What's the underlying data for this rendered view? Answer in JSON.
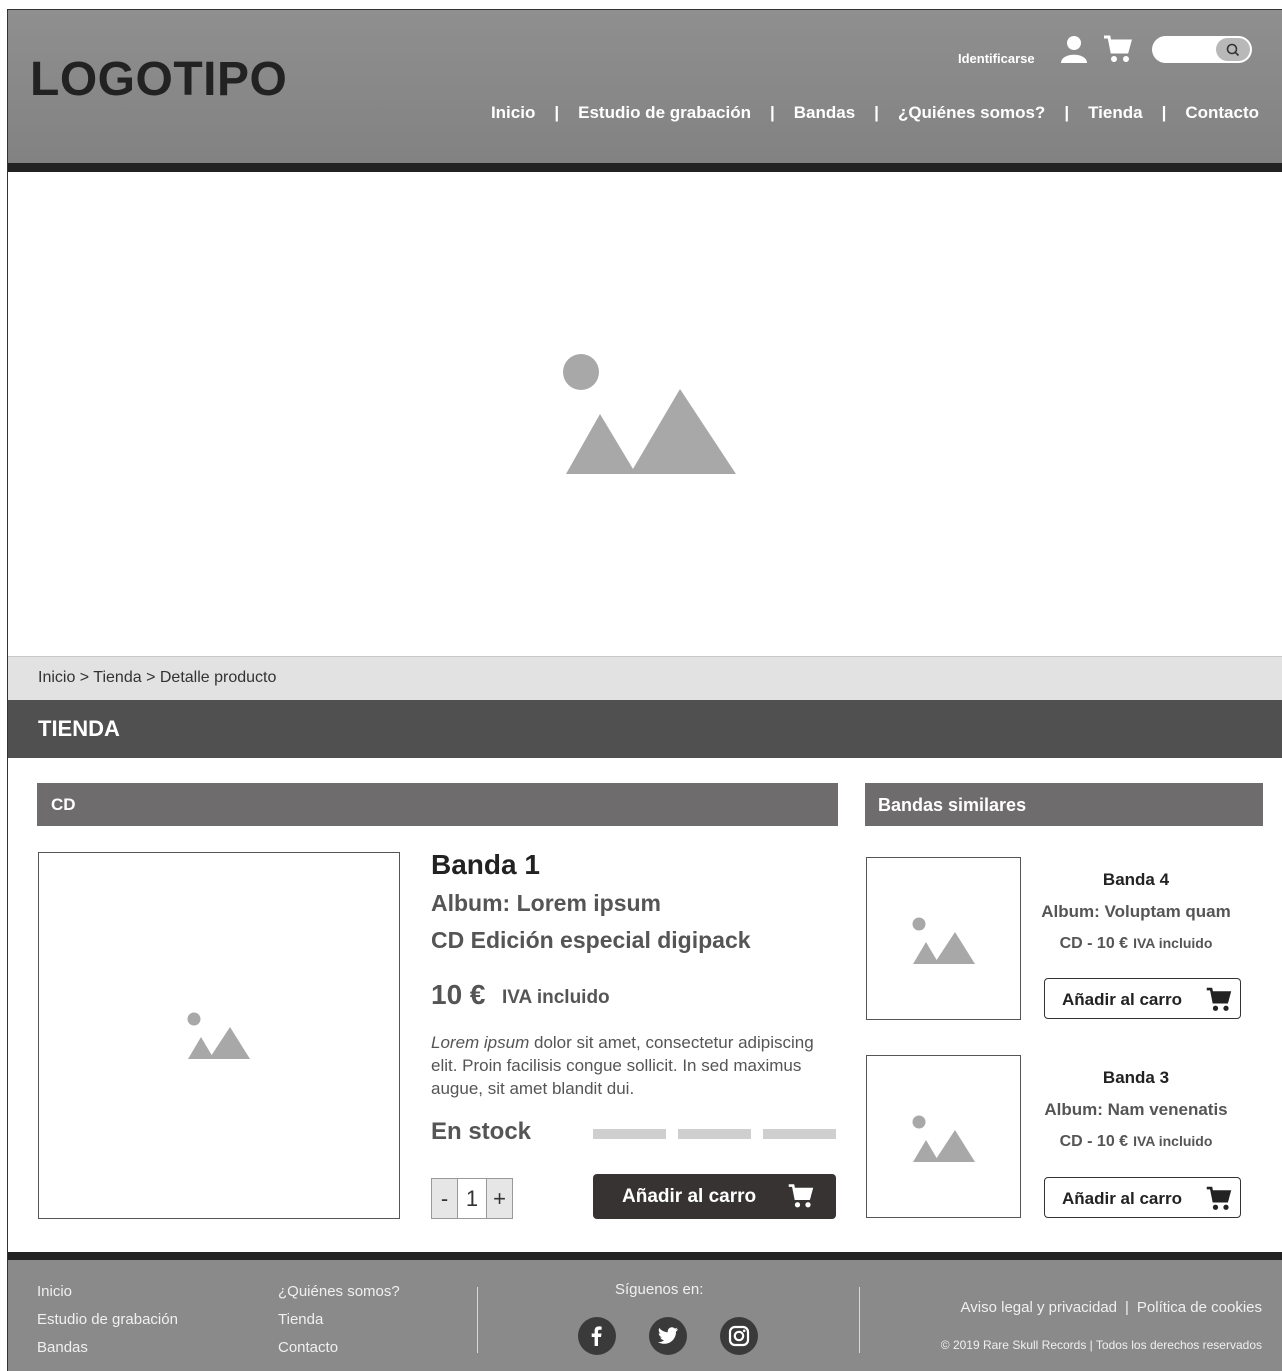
{
  "header": {
    "logo": "LOGOTIPO",
    "login_label": "Identificarse",
    "nav": [
      "Inicio",
      "Estudio de grabación",
      "Bandas",
      "¿Quiénes somos?",
      "Tienda",
      "Contacto"
    ],
    "nav_separator": "|",
    "icons": {
      "user": "user-icon",
      "cart": "cart-icon",
      "search": "search-icon"
    }
  },
  "hero": {
    "icon": "image-placeholder-icon"
  },
  "breadcrumb": "Inicio > Tienda > Detalle producto",
  "section_title": "TIENDA",
  "category_title": "CD",
  "product": {
    "band": "Banda 1",
    "album": "Album: Lorem ipsum",
    "edition": "CD Edición especial digipack",
    "price": "10 €",
    "tax": "IVA incluido",
    "desc_em": "Lorem ipsum",
    "desc_rest": " dolor sit amet, consectetur adipiscing elit. Proin facilisis congue sollicit. In sed maximus augue, sit amet blandit dui.",
    "stock": "En stock",
    "qty_minus": "-",
    "qty_value": "1",
    "qty_plus": "+",
    "add_label": "Añadir al carro"
  },
  "similar": {
    "title": "Bandas similares",
    "items": [
      {
        "name": "Banda 4",
        "album": "Album: Voluptam quam",
        "price": "CD - 10 €",
        "tax": "IVA incluido",
        "add_label": "Añadir al carro"
      },
      {
        "name": "Banda 3",
        "album": "Album: Nam venenatis",
        "price": "CD - 10 €",
        "tax": "IVA incluido",
        "add_label": "Añadir al carro"
      }
    ]
  },
  "footer": {
    "col1": [
      "Inicio",
      "Estudio de grabación",
      "Bandas"
    ],
    "col2": [
      "¿Quiénes somos?",
      "Tienda",
      "Contacto"
    ],
    "follow": "Síguenos en:",
    "social": [
      "facebook-icon",
      "twitter-icon",
      "instagram-icon"
    ],
    "legal": [
      "Aviso legal y privacidad",
      "Política de cookies"
    ],
    "legal_separator": "|",
    "copyright": "© 2019 Rare Skull Records | Todos los derechos reservados"
  },
  "colors": {
    "header": "#888888",
    "dark_bar": "#222222",
    "section": "#505050",
    "subheader": "#6e6c6c",
    "breadcrumb_bg": "#e2e2e2",
    "footer": "#8a8a8a"
  }
}
